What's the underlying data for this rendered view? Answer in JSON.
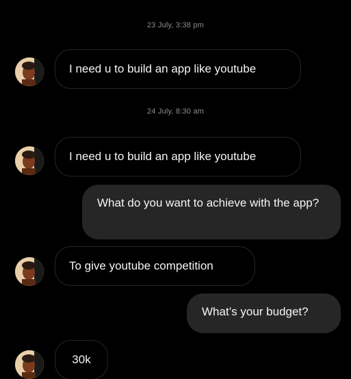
{
  "conversation": {
    "timestamps": [
      "23 July, 3:38 pm",
      "24 July, 8:30 am"
    ],
    "messages": [
      {
        "from": "contact",
        "text": "I need u to build an app like youtube"
      },
      {
        "from": "contact",
        "text": "I need u to build an app like youtube"
      },
      {
        "from": "me",
        "text": "What do you want to achieve with the app?"
      },
      {
        "from": "contact",
        "text": "To give youtube competition"
      },
      {
        "from": "me",
        "text": "What’s your budget?"
      },
      {
        "from": "contact",
        "text": "30k"
      }
    ]
  },
  "colors": {
    "background": "#000000",
    "outgoing_bubble": "#262626",
    "incoming_border": "#262626",
    "timestamp": "#8e8e8e",
    "text": "#f5f5f5"
  },
  "icons": {
    "avatar": "contact-avatar-photo"
  }
}
